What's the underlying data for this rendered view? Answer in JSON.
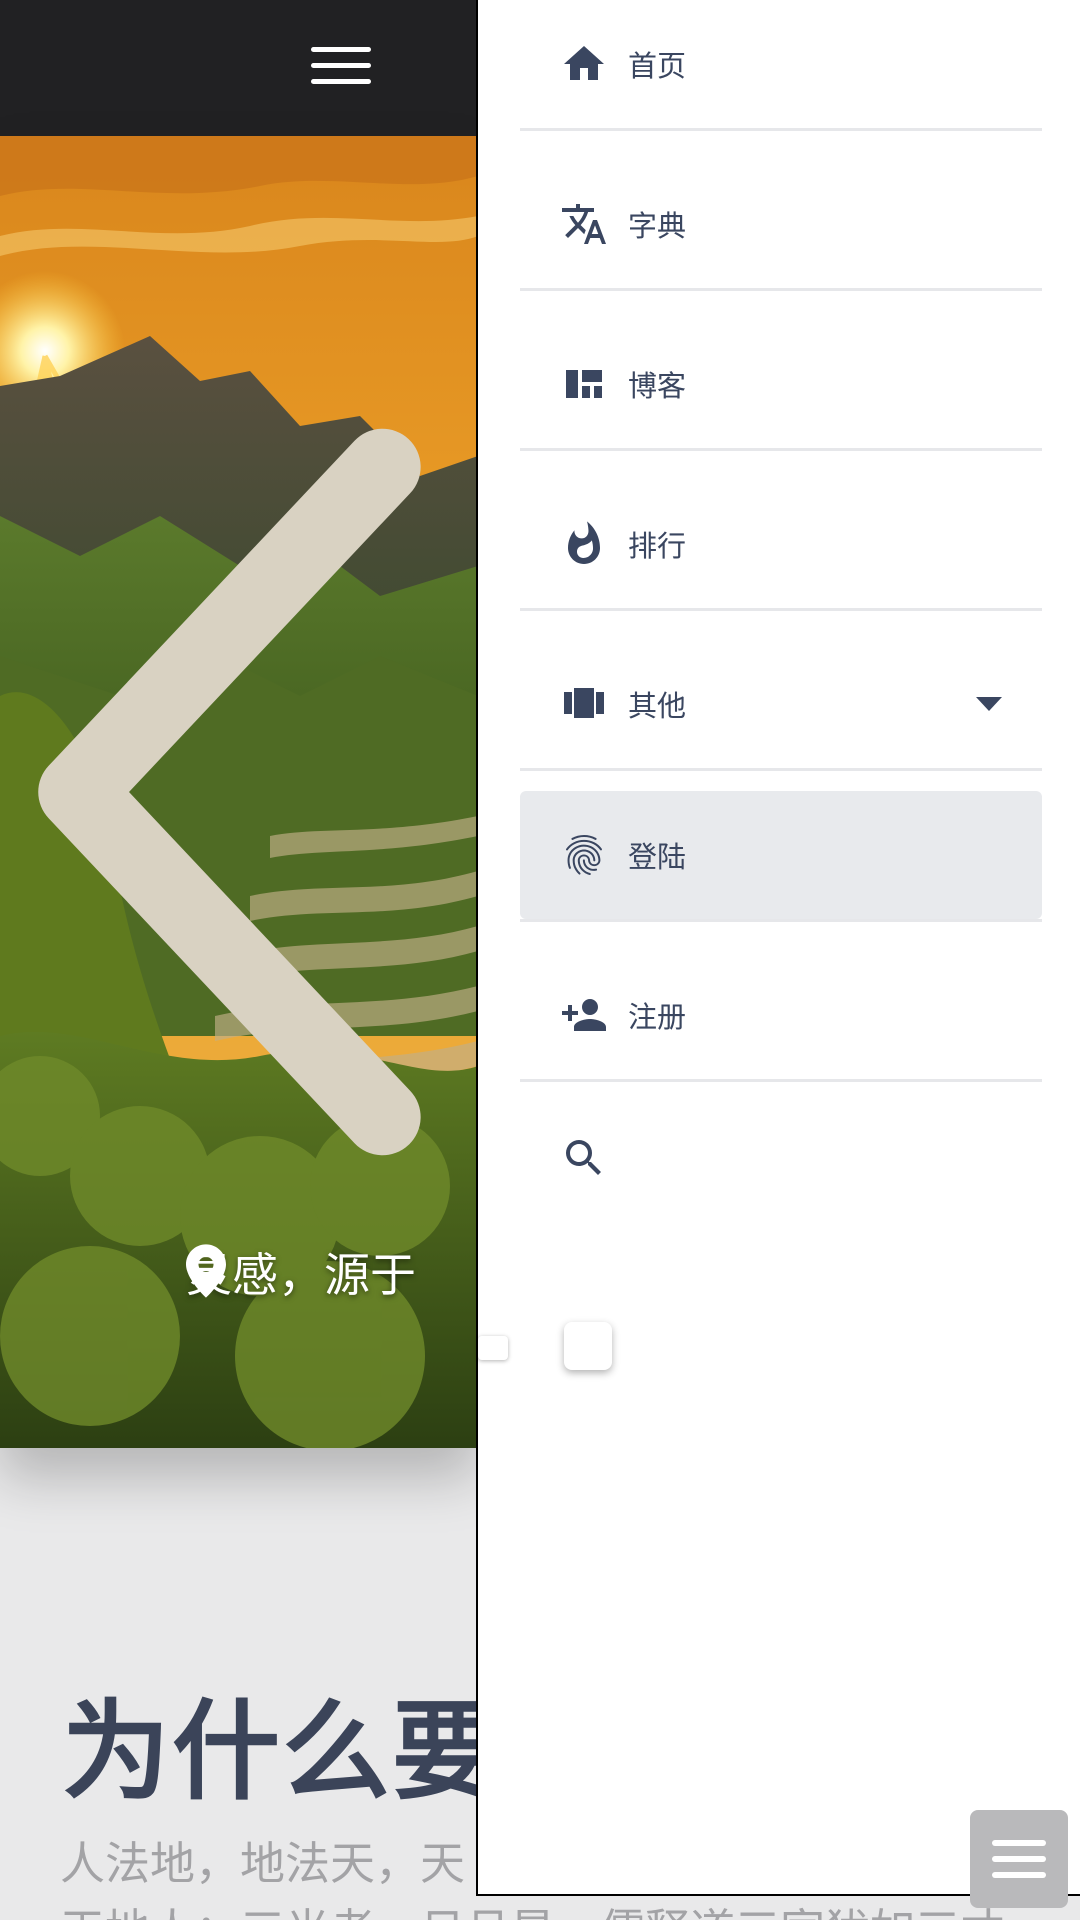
{
  "topbar": {
    "menu_icon": "hamburger-icon"
  },
  "hero": {
    "caption": "灵感，源于",
    "caption_icon": "location-pin-icon",
    "prev_icon": "chevron-left-icon"
  },
  "content": {
    "title": "为什么要试",
    "line1": "人法地，地法天，天",
    "line2": "天地人；三光者，日月星，儒释道三家犹如三才"
  },
  "drawer": {
    "items": [
      {
        "label": "首页",
        "icon": "home-icon"
      },
      {
        "label": "字典",
        "icon": "translate-icon"
      },
      {
        "label": "博客",
        "icon": "dashboard-icon"
      },
      {
        "label": "排行",
        "icon": "fire-icon"
      },
      {
        "label": "其他",
        "icon": "view-carousel-icon",
        "has_dropdown": true
      },
      {
        "label": "登陆",
        "icon": "fingerprint-icon",
        "active": true
      },
      {
        "label": "注册",
        "icon": "person-add-icon"
      }
    ],
    "search_icon": "search-icon"
  },
  "colors": {
    "topbar": "#212123",
    "drawer_text": "#3a4660",
    "active_item_bg": "#e8eaed",
    "divider": "#e6e7ea",
    "page_bg": "#e9e9ea"
  }
}
